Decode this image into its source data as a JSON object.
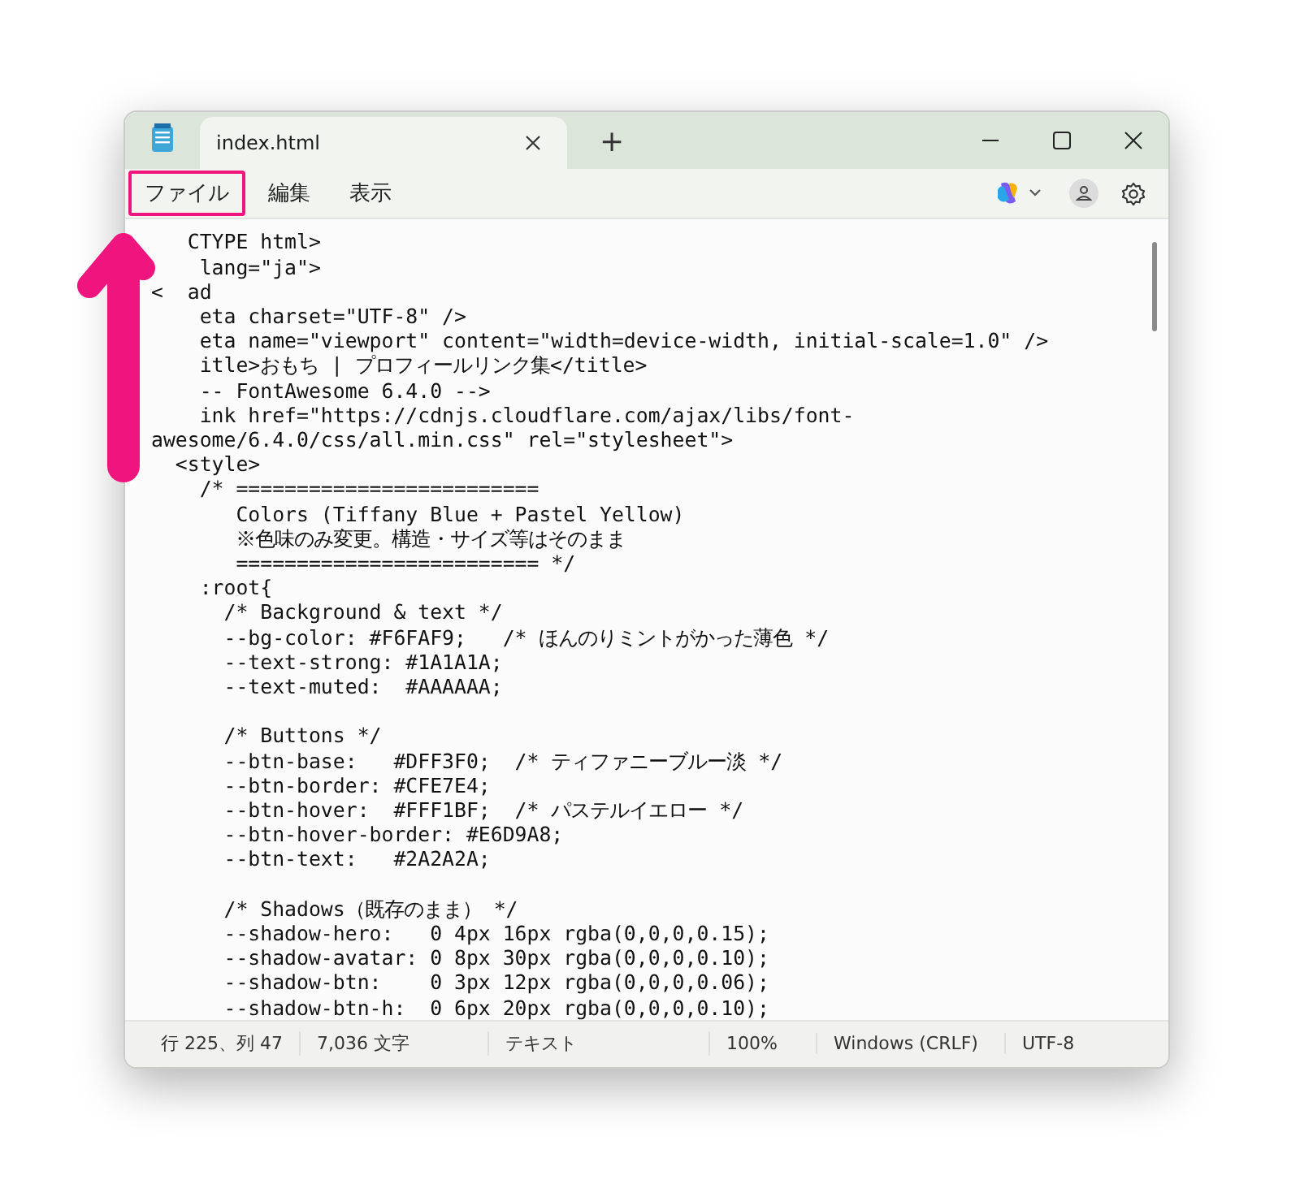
{
  "tabs": [
    {
      "label": "index.html",
      "selected": true
    }
  ],
  "new_tab": "+",
  "menu": [
    {
      "label": "ファイル",
      "highlighted": true
    },
    {
      "label": "編集",
      "highlighted": false
    },
    {
      "label": "表示",
      "highlighted": false
    }
  ],
  "code_blocks": [
    [
      "   CTYPE html>",
      "    lang=\"ja\">",
      [
        "<",
        "ad"
      ],
      "    eta charset=\"UTF-8\" />",
      "    eta name=\"viewport\" content=\"width=device-width, initial-scale=1.0\" />",
      "    itle>おもち | プロフィールリンク集</title>",
      "    -- FontAwesome 6.4.0 -->",
      "    ink href=\"https://cdnjs.cloudflare.com/ajax/libs/font-",
      "awesome/6.4.0/css/all.min.css\" rel=\"stylesheet\">",
      "  <style>",
      "    /* =========================",
      "       Colors (Tiffany Blue + Pastel Yellow)",
      "       ※色味のみ変更。構造・サイズ等はそのまま",
      "       ========================= */",
      "    :root{",
      "      /* Background & text */",
      "      --bg-color: #F6FAF9;   /* ほんのりミントがかった薄色 */",
      "      --text-strong: #1A1A1A;",
      "      --text-muted:  #AAAAAA;"
    ],
    [
      "      /* Buttons */",
      "      --btn-base:   #DFF3F0;  /* ティファニーブルー淡 */",
      "      --btn-border: #CFE7E4;",
      "      --btn-hover:  #FFF1BF;  /* パステルイエロー */",
      "      --btn-hover-border: #E6D9A8;",
      "      --btn-text:   #2A2A2A;"
    ],
    [
      "      /* Shadows（既存のまま） */",
      "      --shadow-hero:   0 4px 16px rgba(0,0,0,0.15);",
      "      --shadow-avatar: 0 8px 30px rgba(0,0,0,0.10);",
      "      --shadow-btn:    0 3px 12px rgba(0,0,0,0.06);",
      "      --shadow-btn-h:  0 6px 20px rgba(0,0,0,0.10);"
    ]
  ],
  "status_bar": [
    "行 225、列 47",
    "7,036 文字",
    "テキスト",
    "100%",
    "Windows (CRLF)",
    "UTF-8"
  ]
}
